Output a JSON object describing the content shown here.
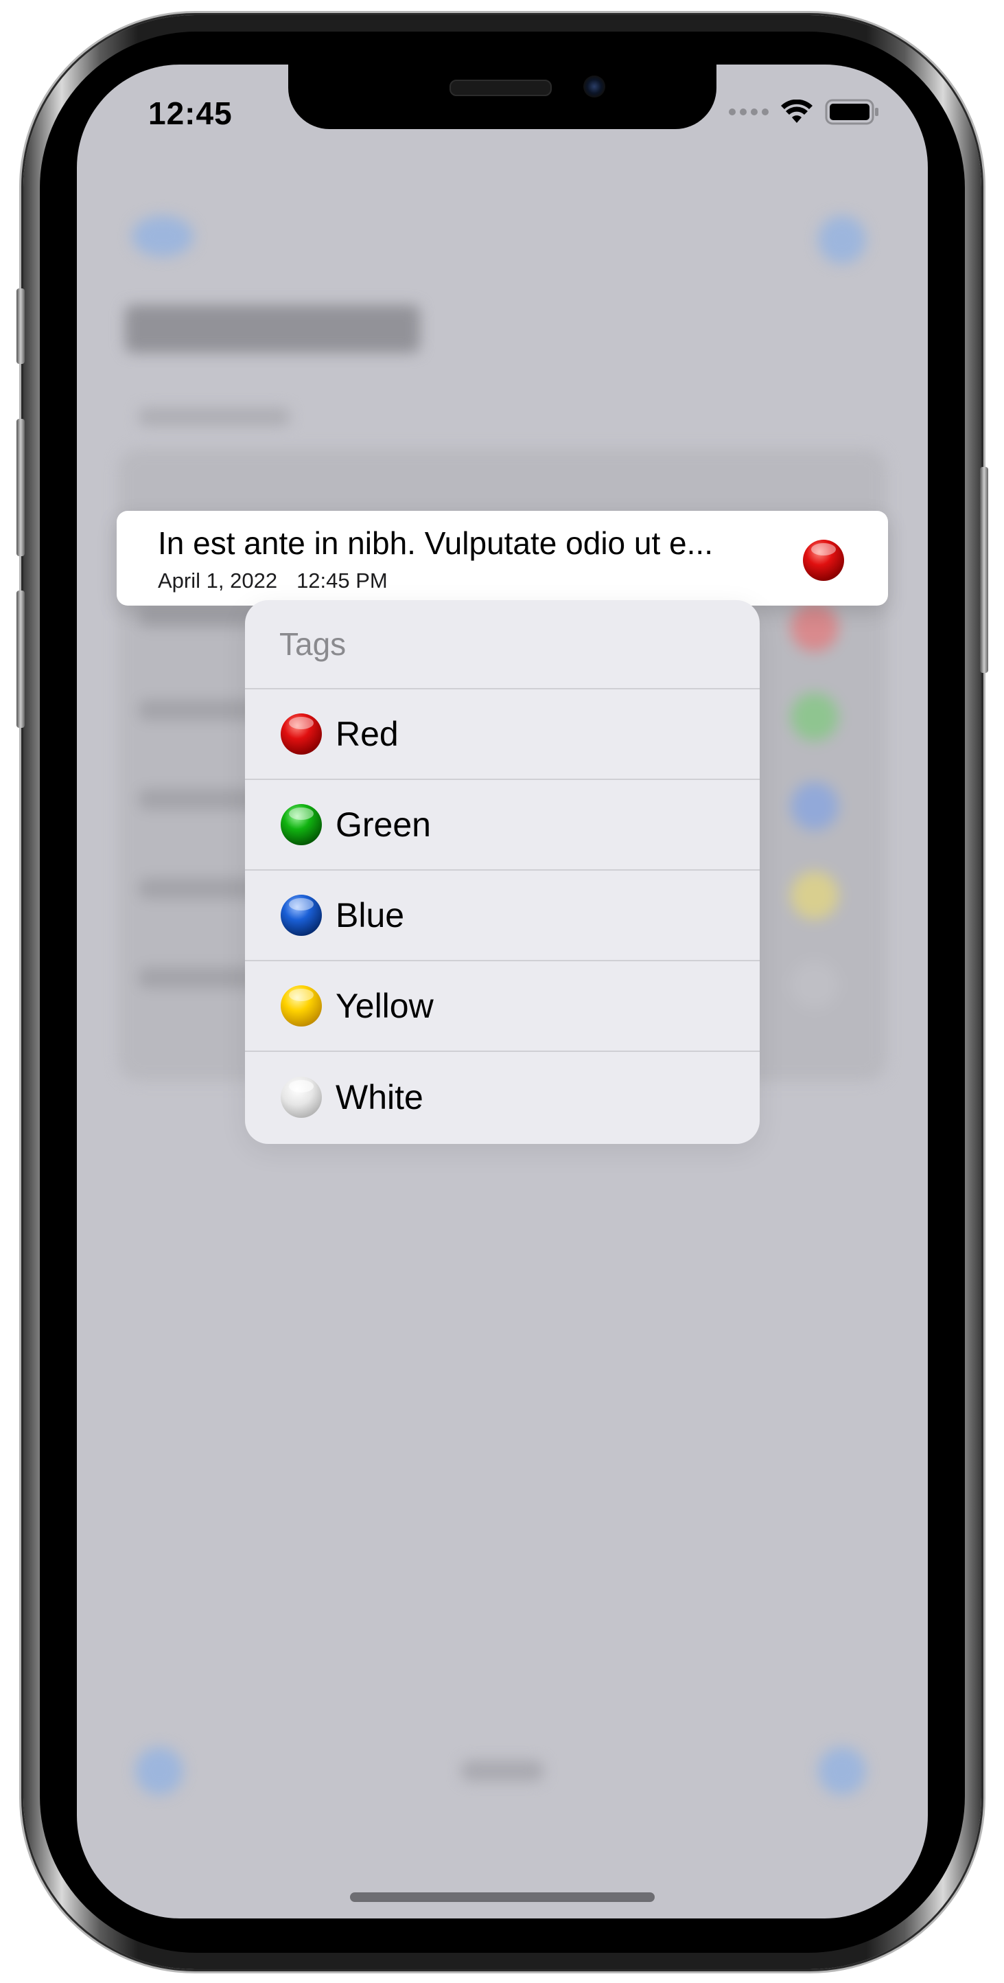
{
  "status_bar": {
    "time": "12:45"
  },
  "note_preview": {
    "title": "In est ante in nibh. Vulputate odio ut e...",
    "date": "April 1, 2022",
    "time": "12:45 PM",
    "tag_color": "#e01010"
  },
  "tags_menu": {
    "header": "Tags",
    "items": [
      {
        "label": "Red",
        "color": "#e01010",
        "icon": "red-circle-icon"
      },
      {
        "label": "Green",
        "color": "#11b311",
        "icon": "green-circle-icon"
      },
      {
        "label": "Blue",
        "color": "#1a5fd6",
        "icon": "blue-circle-icon"
      },
      {
        "label": "Yellow",
        "color": "#ffd200",
        "icon": "yellow-circle-icon"
      },
      {
        "label": "White",
        "color": "#e6e6e6",
        "icon": "white-circle-icon"
      }
    ]
  }
}
